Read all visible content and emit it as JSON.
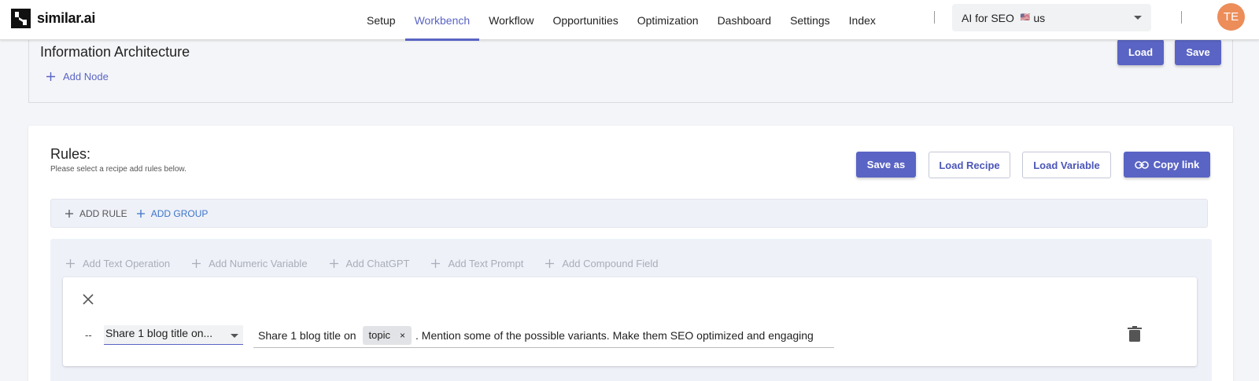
{
  "brand": {
    "name": "similar.ai"
  },
  "nav": {
    "items": [
      {
        "label": "Setup"
      },
      {
        "label": "Workbench"
      },
      {
        "label": "Workflow"
      },
      {
        "label": "Opportunities"
      },
      {
        "label": "Optimization"
      },
      {
        "label": "Dashboard"
      },
      {
        "label": "Settings"
      },
      {
        "label": "Index"
      }
    ],
    "active": "Workbench"
  },
  "project": {
    "name": "AI for SEO",
    "flag": "🇺🇸",
    "country": "us"
  },
  "user": {
    "initials": "TE",
    "avatar_color": "#ec8d5a"
  },
  "ia": {
    "title": "Information Architecture",
    "add_node_label": "Add Node",
    "load_label": "Load",
    "save_label": "Save"
  },
  "rules": {
    "title": "Rules:",
    "subtitle": "Please select a recipe add rules below.",
    "save_as_label": "Save as",
    "load_recipe_label": "Load Recipe",
    "load_variable_label": "Load Variable",
    "copy_link_label": "Copy link",
    "add_rule_label": "ADD RULE",
    "add_group_label": "ADD GROUP",
    "operations": [
      {
        "label": "Add Text Operation"
      },
      {
        "label": "Add Numeric Variable"
      },
      {
        "label": "Add ChatGPT"
      },
      {
        "label": "Add Text Prompt"
      },
      {
        "label": "Add Compound Field"
      }
    ],
    "row": {
      "prefix": "--",
      "recipe_value": "Share 1 blog title on...",
      "prompt_before": "Share 1 blog title on",
      "chip_label": "topic",
      "chip_remove": "×",
      "prompt_after": ". Mention some of the possible variants. Make them SEO optimized and engaging"
    }
  },
  "colors": {
    "accent": "#5a64c4",
    "disabled_text": "#a9adb7"
  }
}
